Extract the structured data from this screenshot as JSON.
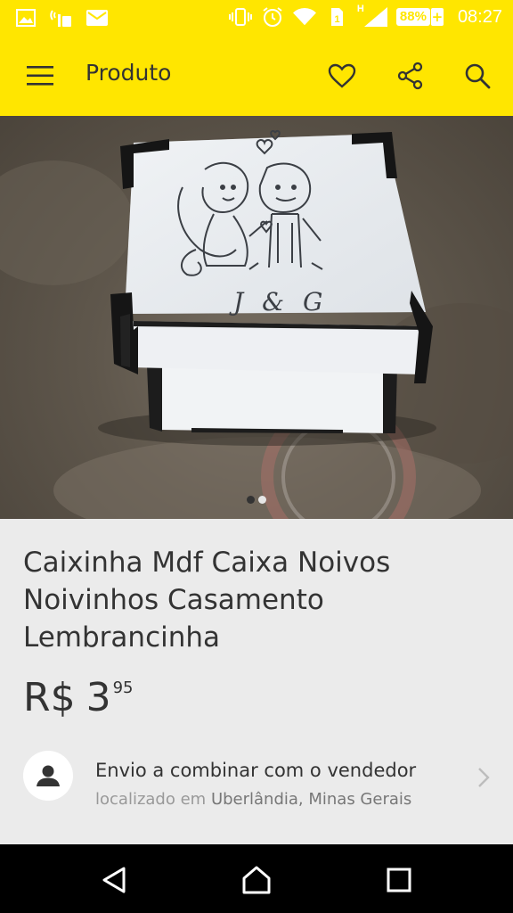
{
  "status_bar": {
    "left_icons": [
      "image-icon",
      "sim-signal-icon",
      "mail-icon"
    ],
    "right_icons": [
      "vibrate-icon",
      "alarm-icon",
      "wifi-icon",
      "sim-1-icon",
      "cell-signal-icon"
    ],
    "network_label": "H",
    "battery_percent": "88%",
    "time": "08:27"
  },
  "app_bar": {
    "title": "Produto",
    "background": "#ffe600",
    "actions": [
      "heart-icon",
      "share-icon",
      "search-icon"
    ]
  },
  "gallery": {
    "image_label": "product-photo",
    "engraving_text": "J & G",
    "page_count": 2,
    "active_index": 0
  },
  "product": {
    "title": "Caixinha Mdf Caixa Noivos Noivinhos Casamento Lembrancinha",
    "price": {
      "currency": "R$",
      "integer": "3",
      "cents": "95"
    }
  },
  "shipping": {
    "line1": "Envio a combinar com o vendedor",
    "located_prefix": "localizado em",
    "location": "Uberlândia, Minas Gerais"
  },
  "nav_bar": {
    "buttons": [
      "back-icon",
      "home-icon",
      "recents-icon"
    ]
  }
}
